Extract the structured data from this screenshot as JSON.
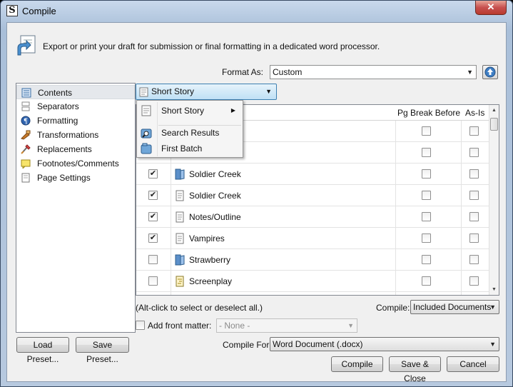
{
  "window": {
    "title": "Compile",
    "close_glyph": "✕"
  },
  "header": {
    "description": "Export or print your draft for submission or final formatting in a dedicated word processor."
  },
  "format_as": {
    "label": "Format As:",
    "value": "Custom"
  },
  "sidebar": {
    "items": [
      {
        "label": "Contents",
        "icon": "contents-icon",
        "selected": true
      },
      {
        "label": "Separators",
        "icon": "separators-icon"
      },
      {
        "label": "Formatting",
        "icon": "formatting-icon"
      },
      {
        "label": "Transformations",
        "icon": "transformations-icon"
      },
      {
        "label": "Replacements",
        "icon": "replacements-icon"
      },
      {
        "label": "Footnotes/Comments",
        "icon": "footnotes-icon"
      },
      {
        "label": "Page Settings",
        "icon": "page-settings-icon"
      }
    ]
  },
  "content_source": {
    "value": "Short Story"
  },
  "dropdown": {
    "items": [
      {
        "label": "Short Story",
        "submenu_glyph": "▶"
      },
      {
        "label": "Search Results"
      },
      {
        "label": "First Batch"
      }
    ]
  },
  "table": {
    "columns": {
      "pg_break": "Pg Break Before",
      "as_is": "As-Is"
    },
    "rows": [
      {
        "include": null,
        "title": "",
        "pg_break": false,
        "as_is": false
      },
      {
        "include": null,
        "title": "",
        "pg_break": false,
        "as_is": false
      },
      {
        "include": true,
        "title": "Soldier Creek",
        "icon": "folder-icon",
        "pg_break": false,
        "as_is": false
      },
      {
        "include": true,
        "title": "Soldier Creek",
        "icon": "document-icon",
        "pg_break": false,
        "as_is": false
      },
      {
        "include": true,
        "title": "Notes/Outline",
        "icon": "document-icon",
        "pg_break": false,
        "as_is": false
      },
      {
        "include": true,
        "title": "Vampires",
        "icon": "document-icon",
        "pg_break": false,
        "as_is": false
      },
      {
        "include": false,
        "title": "Strawberry",
        "icon": "folder-icon",
        "pg_break": false,
        "as_is": false
      },
      {
        "include": false,
        "title": "Screenplay",
        "icon": "screenplay-icon",
        "pg_break": false,
        "as_is": false
      }
    ],
    "check_glyph": "✔"
  },
  "hint": "(Alt-click to select or deselect all.)",
  "compile_scope": {
    "label": "Compile:",
    "value": "Included Documents"
  },
  "front_matter": {
    "label": "Add front matter:",
    "value": "- None -"
  },
  "compile_for": {
    "label": "Compile For:",
    "value": "Word Document (.docx)"
  },
  "buttons": {
    "load_preset": "Load Preset...",
    "save_preset": "Save Preset...",
    "compile": "Compile",
    "save_close": "Save & Close",
    "cancel": "Cancel"
  },
  "colors": {
    "accent": "#3c7fb1",
    "folder": "#5b8fc9"
  }
}
